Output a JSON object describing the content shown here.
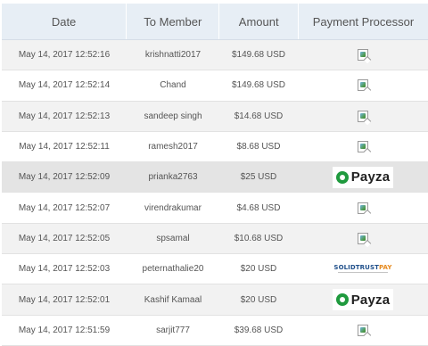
{
  "headers": {
    "date": "Date",
    "member": "To Member",
    "amount": "Amount",
    "processor": "Payment Processor"
  },
  "rows": [
    {
      "date": "May 14, 2017 12:52:16",
      "member": "krishnatti2017",
      "amount": "$149.68 USD",
      "processor": "broken-image-icon"
    },
    {
      "date": "May 14, 2017 12:52:14",
      "member": "Chand",
      "amount": "$149.68 USD",
      "processor": "broken-image-icon"
    },
    {
      "date": "May 14, 2017 12:52:13",
      "member": "sandeep singh",
      "amount": "$14.68 USD",
      "processor": "broken-image-icon"
    },
    {
      "date": "May 14, 2017 12:52:11",
      "member": "ramesh2017",
      "amount": "$8.68 USD",
      "processor": "broken-image-icon"
    },
    {
      "date": "May 14, 2017 12:52:09",
      "member": "prianka2763",
      "amount": "$25 USD",
      "processor": "payza-logo"
    },
    {
      "date": "May 14, 2017 12:52:07",
      "member": "virendrakumar",
      "amount": "$4.68 USD",
      "processor": "broken-image-icon"
    },
    {
      "date": "May 14, 2017 12:52:05",
      "member": "spsamal",
      "amount": "$10.68 USD",
      "processor": "broken-image-icon"
    },
    {
      "date": "May 14, 2017 12:52:03",
      "member": "peternathalie20",
      "amount": "$20 USD",
      "processor": "solidtrustpay-logo"
    },
    {
      "date": "May 14, 2017 12:52:01",
      "member": "Kashif Kamaal",
      "amount": "$20 USD",
      "processor": "payza-logo"
    },
    {
      "date": "May 14, 2017 12:51:59",
      "member": "sarjit777",
      "amount": "$39.68 USD",
      "processor": "broken-image-icon"
    }
  ],
  "logos": {
    "payza_text": "Payza",
    "stp_part1": "SOLIDTRUST",
    "stp_part2": "PAY"
  },
  "colors": {
    "header_bg": "#e7eef5",
    "row_odd_bg": "#f2f2f2",
    "row_highlight_bg": "#e4e4e4",
    "payza_green": "#1f9a3e",
    "stp_blue": "#1f4f8a",
    "stp_orange": "#e68a1f"
  }
}
